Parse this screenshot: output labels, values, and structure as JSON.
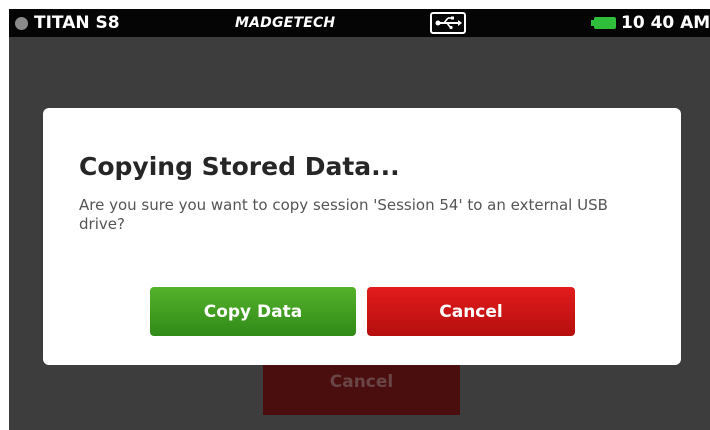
{
  "status_bar": {
    "device_name": "TITAN S8",
    "brand": "MADGETECH",
    "usb_icon": "usb-icon",
    "battery_icon": "battery-icon",
    "battery_color": "#2fbf3a",
    "time": "10 40 AM"
  },
  "background": {
    "cancel_label": "Cancel"
  },
  "dialog": {
    "title": "Copying Stored Data...",
    "message": "Are you sure you want to copy session 'Session 54' to an external USB drive?",
    "copy_label": "Copy Data",
    "cancel_label": "Cancel",
    "copy_color": "#3f9d22",
    "cancel_color": "#d01616"
  }
}
